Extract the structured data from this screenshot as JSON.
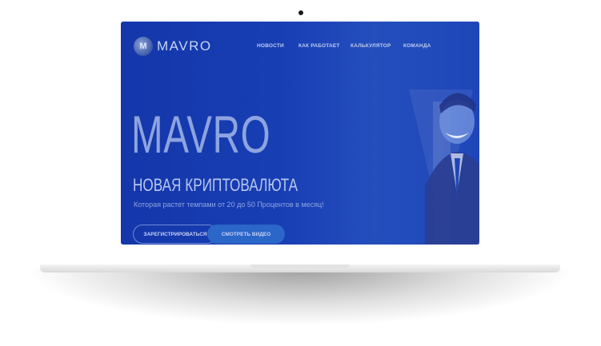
{
  "site": {
    "logo_mark": "M",
    "logo_text": "MAVRO",
    "nav": [
      {
        "label": "НОВОСТИ"
      },
      {
        "label": "КАК РАБОТАЕТ"
      },
      {
        "label": "КАЛЬКУЛЯТОР"
      },
      {
        "label": "КОМАНДА"
      }
    ],
    "hero": {
      "title": "MAVRO",
      "subtitle": "НОВАЯ КРИПТОВАЛЮТА",
      "description": "Которая растет темпами от 20 до 50 Процентов в месяц!"
    },
    "buttons": {
      "register": "ЗАРЕГИСТРИРОВАТЬСЯ",
      "video": "СМОТРЕТЬ ВИДЕО"
    }
  },
  "colors": {
    "screen_blue": "#1a47b8",
    "title_blue": "#8ea4e0",
    "button_blue": "#2b66c9"
  }
}
